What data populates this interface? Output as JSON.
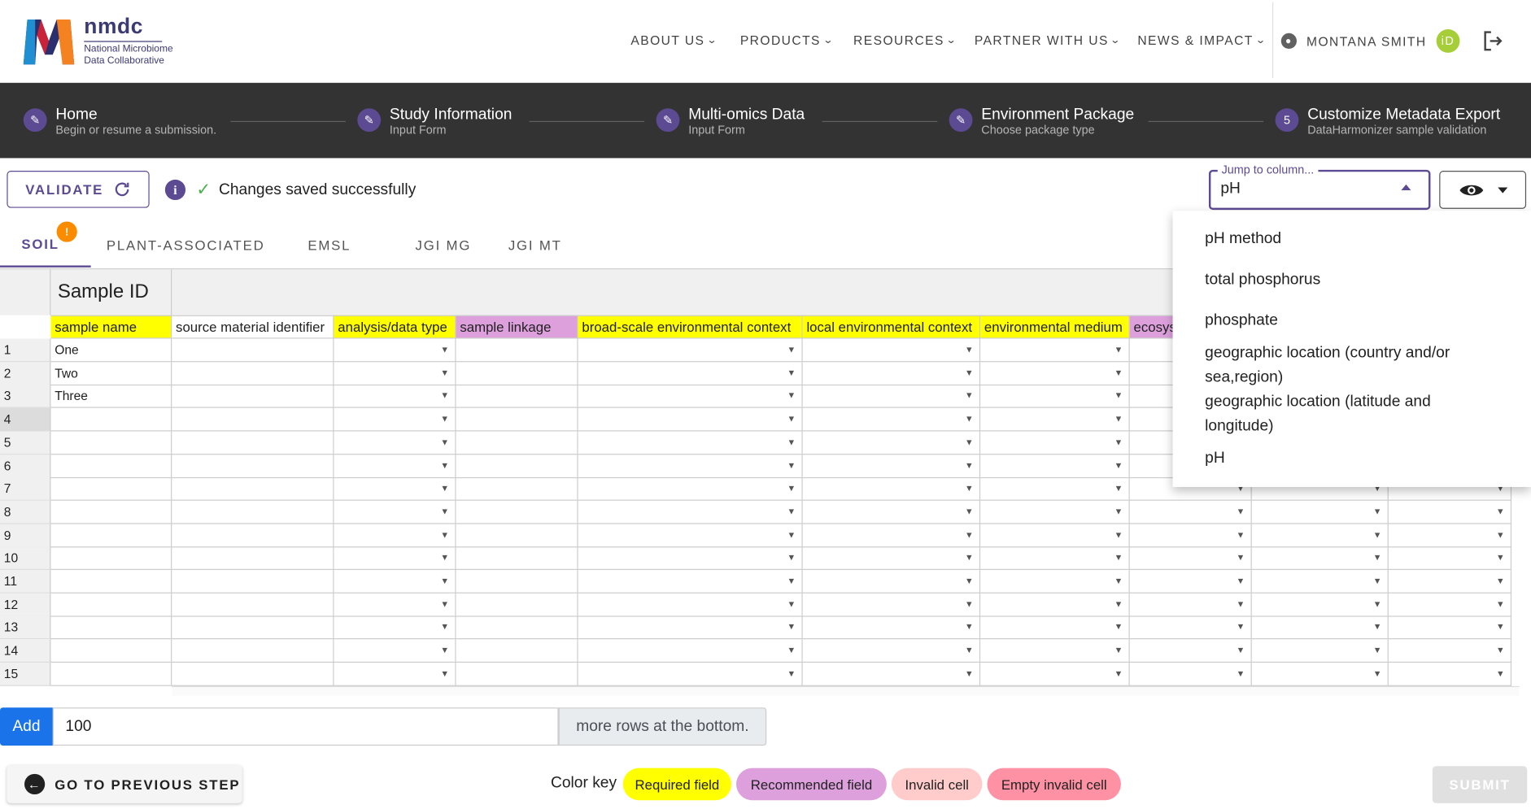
{
  "header": {
    "logo_name": "nmdc",
    "logo_sub1": "National Microbiome",
    "logo_sub2": "Data Collaborative",
    "nav": [
      "ABOUT US",
      "PRODUCTS",
      "RESOURCES",
      "PARTNER WITH US",
      "NEWS & IMPACT"
    ],
    "user_name": "MONTANA SMITH",
    "orcid_label": "iD"
  },
  "stepper": [
    {
      "title": "Home",
      "subtitle": "Begin or resume a submission."
    },
    {
      "title": "Study Information",
      "subtitle": "Input Form"
    },
    {
      "title": "Multi-omics Data",
      "subtitle": "Input Form"
    },
    {
      "title": "Environment Package",
      "subtitle": "Choose package type"
    },
    {
      "number": "5",
      "title": "Customize Metadata Export",
      "subtitle": "DataHarmonizer sample validation"
    }
  ],
  "toolbar": {
    "validate_label": "VALIDATE",
    "info_icon": "i",
    "saved_message": "Changes saved successfully",
    "jump_label": "Jump to column...",
    "jump_value": "pH"
  },
  "tabs": [
    {
      "label": "SOIL",
      "badge": "!"
    },
    {
      "label": "PLANT-ASSOCIATED"
    },
    {
      "label": "EMSL"
    },
    {
      "label": "JGI MG"
    },
    {
      "label": "JGI MT"
    }
  ],
  "grid": {
    "section_title": "Sample ID",
    "columns": [
      "sample name",
      "source material identifier",
      "analysis/data type",
      "sample linkage",
      "broad-scale environmental context",
      "local environmental context",
      "environmental medium",
      "ecosys"
    ],
    "row_numbers": [
      "1",
      "2",
      "3",
      "4",
      "5",
      "6",
      "7",
      "8",
      "9",
      "10",
      "11",
      "12",
      "13",
      "14",
      "15"
    ],
    "sample_names": [
      "One",
      "Two",
      "Three"
    ]
  },
  "dropdown": [
    "pH method",
    "total phosphorus",
    "phosphate",
    "geographic location (country and/or sea,region)",
    "geographic location (latitude and longitude)",
    "pH"
  ],
  "footer": {
    "add_label": "Add",
    "add_value": "100",
    "add_suffix": "more rows at the bottom.",
    "prev_label": "GO TO PREVIOUS STEP",
    "color_key_label": "Color key",
    "chips": [
      "Required field",
      "Recommended field",
      "Invalid cell",
      "Empty invalid cell"
    ],
    "submit_label": "SUBMIT"
  },
  "colors": {
    "accent": "#5c4a93",
    "required": "#ffff00",
    "recommended": "#dda0dd",
    "invalid": "#ffcccb",
    "empty_invalid": "#ff91a4"
  }
}
